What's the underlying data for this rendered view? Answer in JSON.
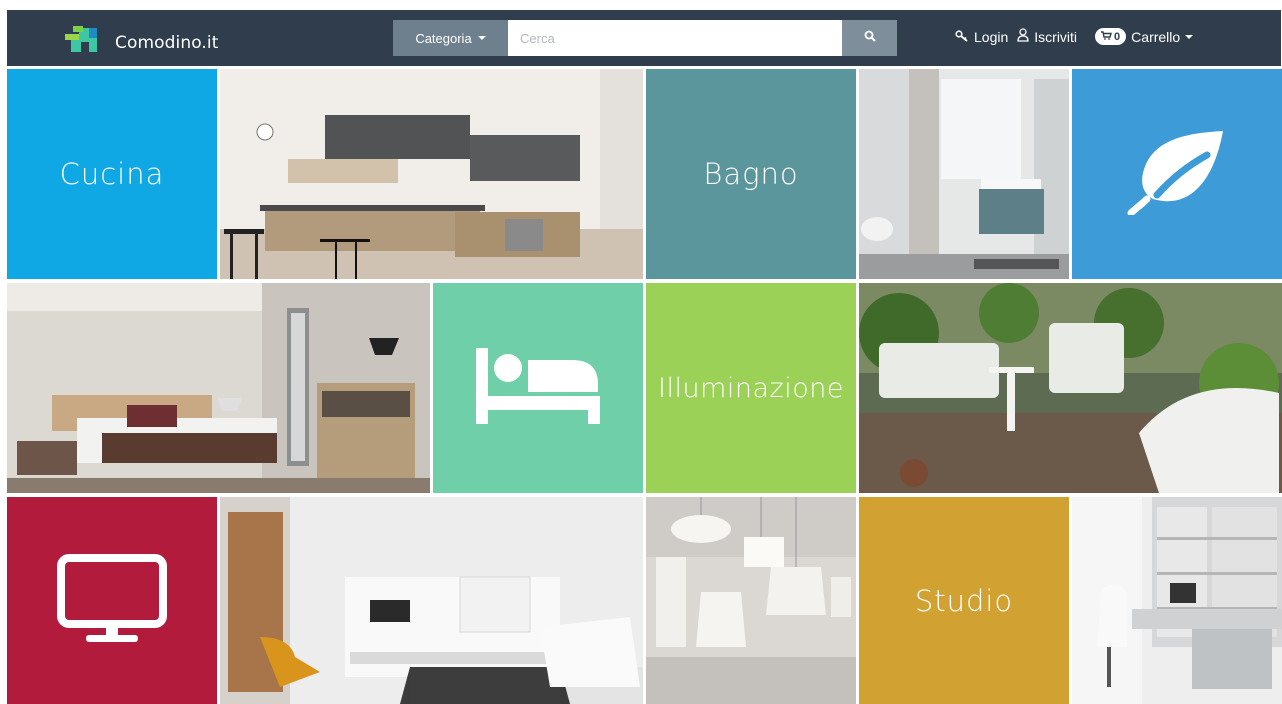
{
  "navbar": {
    "brand": "Comodino.it",
    "category_label": "Categoria",
    "search_placeholder": "Cerca",
    "login_label": "Login",
    "register_label": "Iscriviti",
    "cart_count": "0",
    "cart_label": "Carrello"
  },
  "tiles": {
    "cucina": "Cucina",
    "bagno": "Bagno",
    "illuminazione": "Illuminazione",
    "studio": "Studio"
  },
  "icons": {
    "brand": "house-logo-icon",
    "search": "search-icon",
    "login": "key-icon",
    "register": "user-icon",
    "cart": "cart-icon",
    "garden": "leaf-icon",
    "bedroom": "bed-icon",
    "living": "monitor-icon"
  },
  "colors": {
    "navbar": "#2f3d4c",
    "cucina": "#10a8e4",
    "bagno": "#5b969c",
    "garden": "#3d9bd8",
    "bedroom": "#6ecfa8",
    "illuminazione": "#9cd158",
    "living": "#b31b3c",
    "studio": "#d1a132"
  }
}
